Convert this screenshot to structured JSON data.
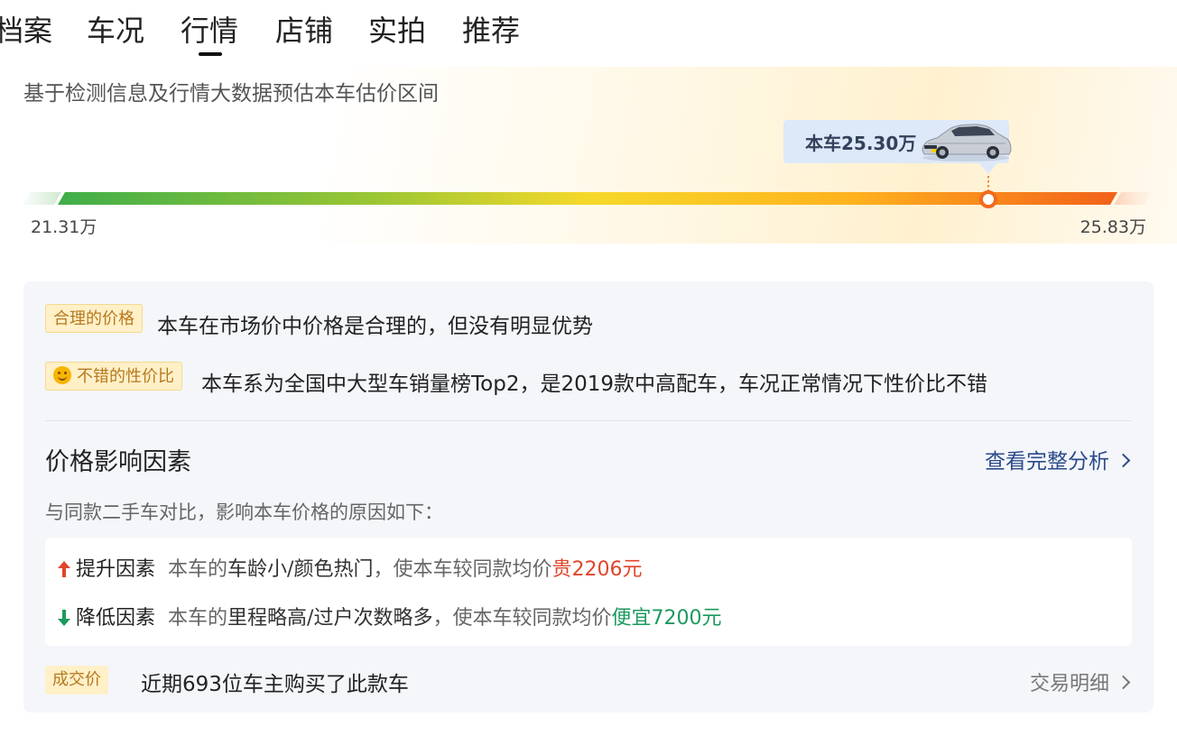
{
  "tabs": [
    {
      "label": "档案"
    },
    {
      "label": "车况"
    },
    {
      "label": "行情",
      "active": true
    },
    {
      "label": "店铺"
    },
    {
      "label": "实拍"
    },
    {
      "label": "推荐"
    }
  ],
  "valuation": {
    "subtitle": "基于检测信息及行情大数据预估本车估价区间",
    "car_price_label": "本车25.30万",
    "range_min": "21.31万",
    "range_max": "25.83万",
    "car_position_fraction": 0.86
  },
  "assessment": {
    "reasonable_badge": "合理的价格",
    "reasonable_text": "本车在市场价中价格是合理的，但没有明显优势",
    "value_badge": "不错的性价比",
    "value_badge_icon": "smile-emoji-icon",
    "value_text": "本车系为全国中大型车销量榜Top2，是2019款中高配车，车况正常情况下性价比不错"
  },
  "factors": {
    "title": "价格影响因素",
    "link": "查看完整分析",
    "subtitle": "与同款二手车对比，影响本车价格的原因如下：",
    "up": {
      "name": "提升因素",
      "prefix": "本车的",
      "highlight": "车龄小/颜色热门",
      "middle": "，使本车较同款均价",
      "amount": "贵2206元"
    },
    "down": {
      "name": "降低因素",
      "prefix": "本车的",
      "highlight": "里程略高/过户次数略多",
      "middle": "，使本车较同款均价",
      "amount": "便宜7200元"
    }
  },
  "deal": {
    "badge": "成交价",
    "text": "近期693位车主购买了此款车",
    "link": "交易明细"
  },
  "colors": {
    "up": "#e0452b",
    "down": "#1c9a5e",
    "link": "#2c4a8a",
    "badge_bg": "#fff0c8",
    "badge_text": "#b7791f"
  }
}
